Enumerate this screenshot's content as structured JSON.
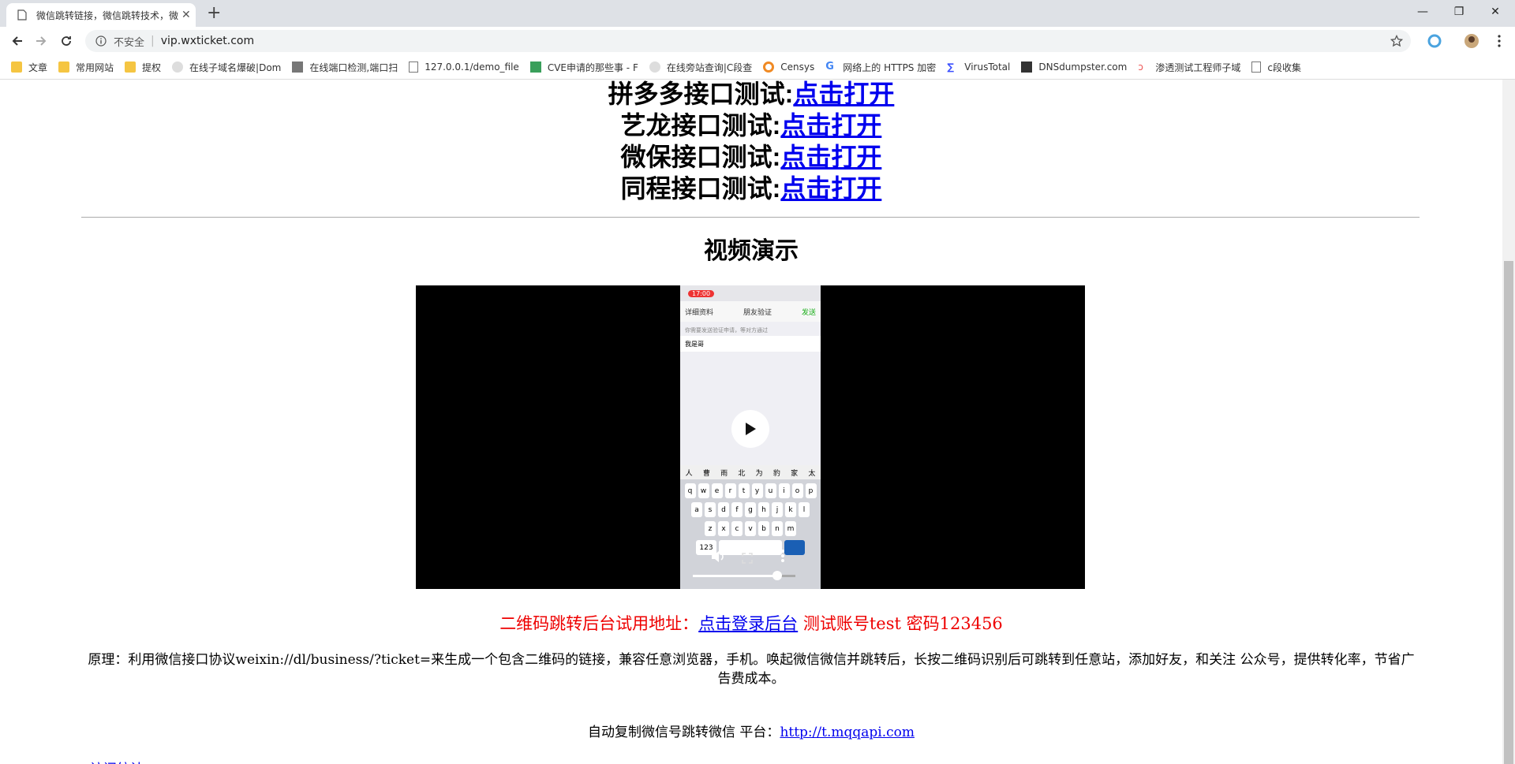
{
  "browser": {
    "tab_title": "微信跳转链接，微信跳转技术，微",
    "tab_close": "✕",
    "new_tab": "+",
    "security_label": "不安全",
    "url": "vip.wxticket.com",
    "window_controls": [
      "—",
      "❐",
      "✕"
    ]
  },
  "bookmarks": [
    {
      "label": "文章",
      "icon": "folder-icon"
    },
    {
      "label": "常用网站",
      "icon": "folder-icon"
    },
    {
      "label": "提权",
      "icon": "folder-icon"
    },
    {
      "label": "在线子域名爆破|Dom",
      "icon": "site-icon"
    },
    {
      "label": "在线端口检测,端口扫",
      "icon": "site-icon"
    },
    {
      "label": "127.0.0.1/demo_file",
      "icon": "page-icon"
    },
    {
      "label": "CVE申请的那些事 - F",
      "icon": "site-icon"
    },
    {
      "label": "在线旁站查询|C段查",
      "icon": "site-icon"
    },
    {
      "label": "Censys",
      "icon": "censys-icon"
    },
    {
      "label": "网络上的 HTTPS 加密",
      "icon": "google-icon"
    },
    {
      "label": "VirusTotal",
      "icon": "virustotal-icon"
    },
    {
      "label": "DNSdumpster.com",
      "icon": "site-icon"
    },
    {
      "label": "渗透测试工程师子域",
      "icon": "site-icon"
    },
    {
      "label": "c段收集",
      "icon": "page-icon"
    }
  ],
  "apis": [
    {
      "label": "拼多多接口测试:",
      "link": "点击打开"
    },
    {
      "label": "艺龙接口测试:",
      "link": "点击打开"
    },
    {
      "label": "微保接口测试:",
      "link": "点击打开"
    },
    {
      "label": "同程接口测试:",
      "link": "点击打开"
    }
  ],
  "video_section": {
    "title": "视频演示",
    "phone": {
      "time": "17:00",
      "back": "详细资料",
      "nav_title": "朋友验证",
      "send": "发送",
      "hint": "你需要发送验证申请，等对方通过",
      "input_value": "我是哥",
      "candidates": [
        "人",
        "曹",
        "雨",
        "北",
        "为",
        "豹",
        "家",
        "太"
      ],
      "row1": [
        "q",
        "w",
        "e",
        "r",
        "t",
        "y",
        "u",
        "i",
        "o",
        "p"
      ],
      "row2": [
        "a",
        "s",
        "d",
        "f",
        "g",
        "h",
        "j",
        "k",
        "l"
      ],
      "row3": [
        "z",
        "x",
        "c",
        "v",
        "b",
        "n",
        "m"
      ],
      "key_123": "123",
      "progress": 0.82
    }
  },
  "trial": {
    "prefix": "二维码跳转后台试用地址：",
    "link": "点击登录后台",
    "suffix": " 测试账号test 密码123456"
  },
  "principle": "原理：利用微信接口协议weixin://dl/business/?ticket=来生成一个包含二维码的链接，兼容任意浏览器，手机。唤起微信微信并跳转后，长按二维码识别后可跳转到任意站，添加好友，和关注 公众号，提供转化率，节省广告费成本。",
  "platform": {
    "prefix": "自动复制微信号跳转微信 平台：",
    "link": "http://t.mqqapi.com"
  },
  "bottom_link": "访问统计"
}
